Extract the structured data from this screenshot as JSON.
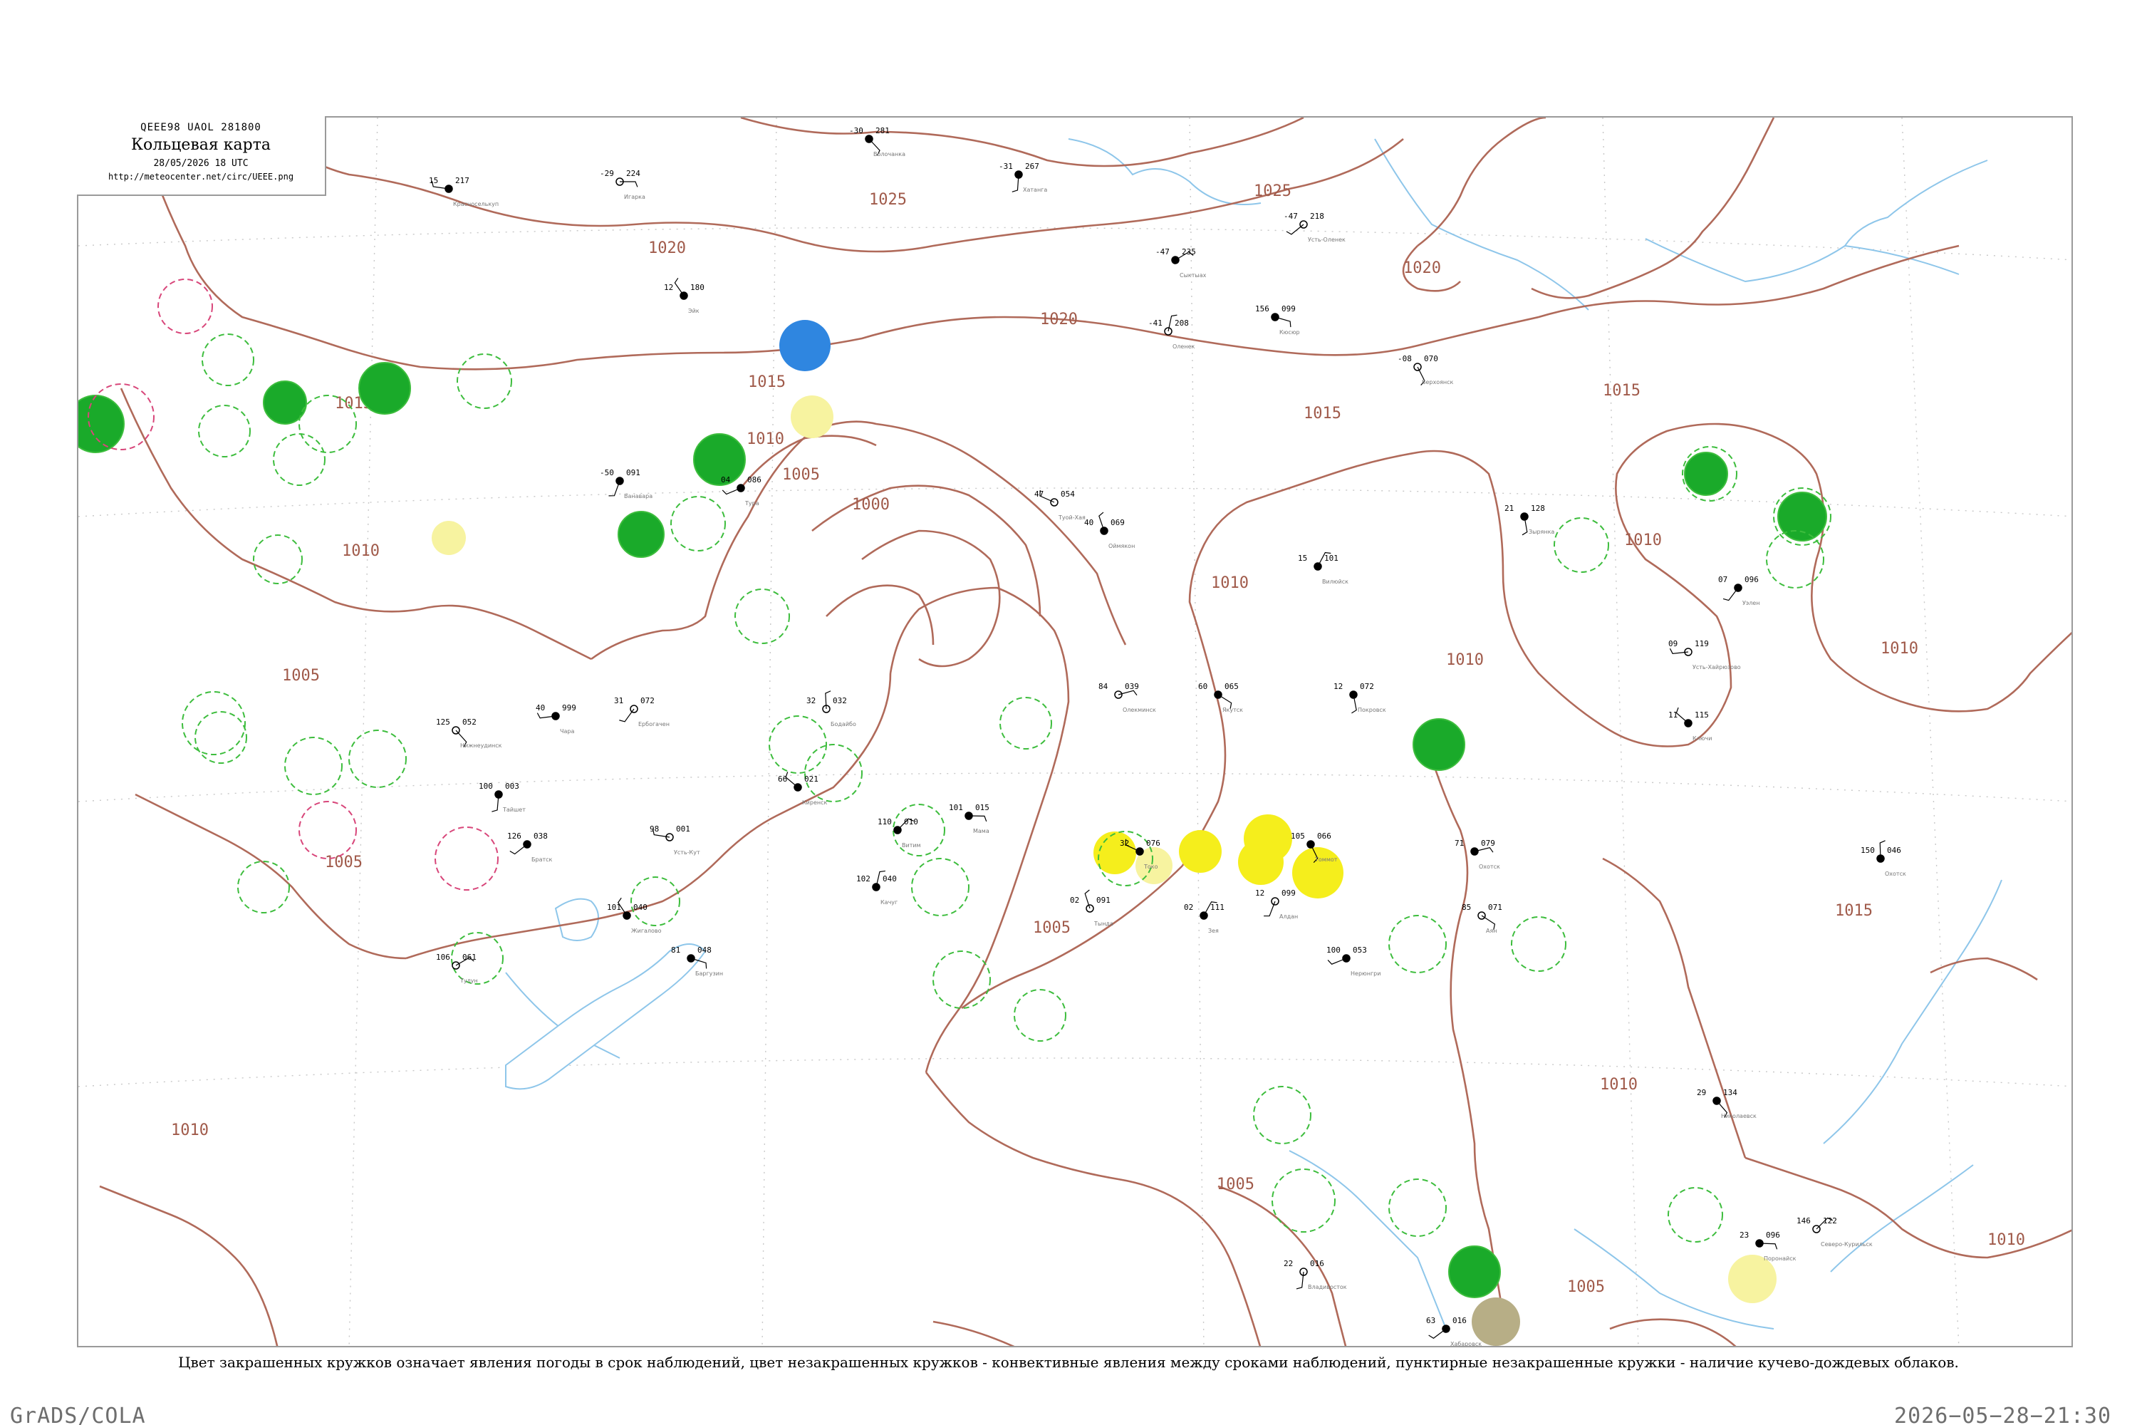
{
  "header": {
    "code": "QEEE98  UAOL  281800",
    "title": "Кольцевая карта",
    "datetime": "28/05/2026 18 UTC",
    "url": "http://meteocenter.net/circ/UEEE.png"
  },
  "legend_caption": "Цвет закрашенных кружков означает явления погоды в срок наблюдений, цвет незакрашенных кружков - конвективные явления между сроками наблюдений, пунктирные незакрашенные кружки - наличие кучево-дождевых облаков.",
  "footer": {
    "software": "GrADS/COLA",
    "timestamp": "2026−05−28−21:30"
  },
  "colors": {
    "isobar": "#b06a5a",
    "coast": "#8ec6ea",
    "rain_fill": "#1aaa2a",
    "snow_fill": "#2f86e0",
    "thunder_fill": "#f5ee1c",
    "haze_fill": "#f7f3a0",
    "dust_fill": "#b7ae86",
    "cb_ring": "#3dbd3d",
    "thunder_ring": "#d8467a"
  },
  "isobars": [
    {
      "label": "1025"
    },
    {
      "label": "1025"
    },
    {
      "label": "1020"
    },
    {
      "label": "1020"
    },
    {
      "label": "1020"
    },
    {
      "label": "1015"
    },
    {
      "label": "1015"
    },
    {
      "label": "1015"
    },
    {
      "label": "1015"
    },
    {
      "label": "1015"
    },
    {
      "label": "1010"
    },
    {
      "label": "1010"
    },
    {
      "label": "1010"
    },
    {
      "label": "1010"
    },
    {
      "label": "1010"
    },
    {
      "label": "1010"
    },
    {
      "label": "1010"
    },
    {
      "label": "1010"
    },
    {
      "label": "1010"
    },
    {
      "label": "1005"
    },
    {
      "label": "1005"
    },
    {
      "label": "1005"
    },
    {
      "label": "1005"
    },
    {
      "label": "1005"
    },
    {
      "label": "1005"
    },
    {
      "label": "1000"
    }
  ],
  "stations": [
    {
      "t": "-29",
      "p": "224",
      "name": "Игарка"
    },
    {
      "t": "-30",
      "p": "281",
      "name": "Волочанка"
    },
    {
      "t": "-31",
      "p": "267",
      "name": "Хатанга"
    },
    {
      "t": "-47",
      "p": "218",
      "name": "Усть-Оленек"
    },
    {
      "t": "15",
      "p": "217",
      "name": "Красноселькуп"
    },
    {
      "t": "12",
      "p": "180",
      "name": "Эйк"
    },
    {
      "t": "-41",
      "p": "208",
      "name": "Оленек"
    },
    {
      "t": "-47",
      "p": "235",
      "name": "Сыктыах"
    },
    {
      "t": "156",
      "p": "099",
      "name": "Кюсюр"
    },
    {
      "t": "-08",
      "p": "070",
      "name": "Верхоянск"
    },
    {
      "t": "-50",
      "p": "091",
      "name": "Ванавара"
    },
    {
      "t": "04",
      "p": "086",
      "name": "Тура"
    },
    {
      "t": "47",
      "p": "054",
      "name": "Туой-Хая"
    },
    {
      "t": "40",
      "p": "069",
      "name": "Оймякон"
    },
    {
      "t": "15",
      "p": "101",
      "name": "Вилюйск"
    },
    {
      "t": "84",
      "p": "039",
      "name": "Олекминск"
    },
    {
      "t": "60",
      "p": "065",
      "name": "Якутск"
    },
    {
      "t": "12",
      "p": "072",
      "name": "Покровск"
    },
    {
      "t": "31",
      "p": "072",
      "name": "Ербогачен"
    },
    {
      "t": "40",
      "p": "999",
      "name": "Чара"
    },
    {
      "t": "66",
      "p": "021",
      "name": "Киренск"
    },
    {
      "t": "32",
      "p": "032",
      "name": "Бодайбо"
    },
    {
      "t": "110",
      "p": "010",
      "name": "Витим"
    },
    {
      "t": "101",
      "p": "015",
      "name": "Мама"
    },
    {
      "t": "125",
      "p": "052",
      "name": "Нижнеудинск"
    },
    {
      "t": "100",
      "p": "003",
      "name": "Тайшет"
    },
    {
      "t": "126",
      "p": "038",
      "name": "Братск"
    },
    {
      "t": "98",
      "p": "001",
      "name": "Усть-Кут"
    },
    {
      "t": "101",
      "p": "040",
      "name": "Жигалово"
    },
    {
      "t": "102",
      "p": "040",
      "name": "Качуг"
    },
    {
      "t": "106",
      "p": "061",
      "name": "Тулун"
    },
    {
      "t": "81",
      "p": "048",
      "name": "Баргузин"
    },
    {
      "t": "105",
      "p": "066",
      "name": "Томмот"
    },
    {
      "t": "12",
      "p": "099",
      "name": "Алдан"
    },
    {
      "t": "100",
      "p": "053",
      "name": "Нерюнгри"
    },
    {
      "t": "32",
      "p": "076",
      "name": "Токо"
    },
    {
      "t": "02",
      "p": "091",
      "name": "Тында"
    },
    {
      "t": "02",
      "p": "111",
      "name": "Зея"
    },
    {
      "t": "71",
      "p": "079",
      "name": "Охотск"
    },
    {
      "t": "85",
      "p": "071",
      "name": "Аян"
    },
    {
      "t": "21",
      "p": "128",
      "name": "Зырянка"
    },
    {
      "t": "07",
      "p": "096",
      "name": "Уэлен"
    },
    {
      "t": "09",
      "p": "119",
      "name": "Усть-Хайрюзово"
    },
    {
      "t": "11",
      "p": "115",
      "name": "Ключи"
    },
    {
      "t": "150",
      "p": "046",
      "name": "Охотск"
    },
    {
      "t": "146",
      "p": "122",
      "name": "Северо-Курильск"
    },
    {
      "t": "23",
      "p": "096",
      "name": "Поронайск"
    },
    {
      "t": "29",
      "p": "134",
      "name": "Николаевск"
    },
    {
      "t": "22",
      "p": "016",
      "name": "Владивосток"
    },
    {
      "t": "63",
      "p": "016",
      "name": "Хабаровск"
    }
  ]
}
